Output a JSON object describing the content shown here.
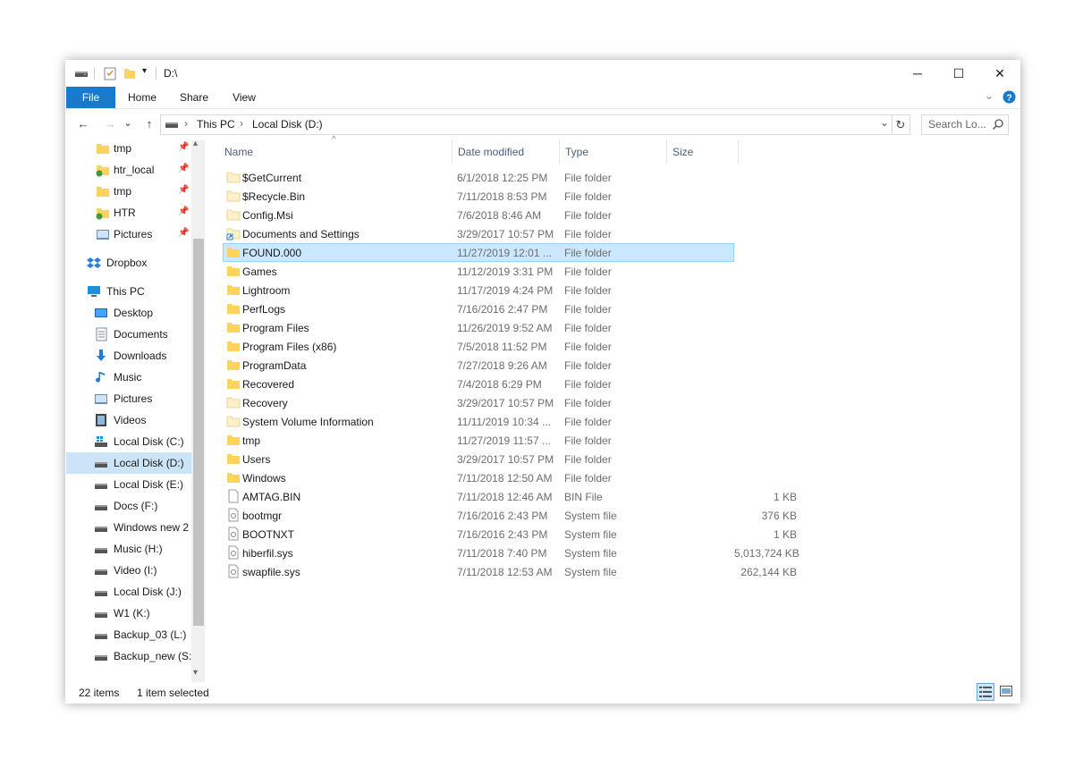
{
  "window": {
    "title": "D:\\",
    "controls": {
      "minimize": "─",
      "maximize": "☐",
      "close": "✕"
    }
  },
  "ribbon": {
    "tabs": [
      "File",
      "Home",
      "Share",
      "View"
    ],
    "expand_icon": "chevron-down-icon",
    "help_icon": "help-icon"
  },
  "address": {
    "back": "←",
    "forward": "→",
    "recent": "⌄",
    "up": "↑",
    "crumbs": [
      "This PC",
      "Local Disk (D:)"
    ],
    "separator": "›",
    "dropdown": "⌄",
    "refresh": "↻",
    "search_placeholder": "Search Lo..."
  },
  "nav": {
    "quick_access": [
      {
        "label": "tmp",
        "icon": "folder-icon",
        "pinned": true
      },
      {
        "label": "htr_local",
        "icon": "folder-sync-icon",
        "pinned": true
      },
      {
        "label": "tmp",
        "icon": "folder-icon",
        "pinned": true
      },
      {
        "label": "HTR",
        "icon": "folder-sync-icon",
        "pinned": true
      },
      {
        "label": "Pictures",
        "icon": "pictures-icon",
        "pinned": true
      }
    ],
    "dropbox": "Dropbox",
    "this_pc": "This PC",
    "pc_items": [
      {
        "label": "Desktop",
        "icon": "desktop-icon"
      },
      {
        "label": "Documents",
        "icon": "documents-icon"
      },
      {
        "label": "Downloads",
        "icon": "downloads-icon"
      },
      {
        "label": "Music",
        "icon": "music-icon"
      },
      {
        "label": "Pictures",
        "icon": "pictures-icon"
      },
      {
        "label": "Videos",
        "icon": "videos-icon"
      },
      {
        "label": "Local Disk (C:)",
        "icon": "windows-drive-icon"
      },
      {
        "label": "Local Disk (D:)",
        "icon": "drive-icon",
        "selected": true
      },
      {
        "label": "Local Disk (E:)",
        "icon": "drive-icon"
      },
      {
        "label": "Docs (F:)",
        "icon": "drive-icon"
      },
      {
        "label": "Windows new 2",
        "icon": "drive-icon"
      },
      {
        "label": "Music (H:)",
        "icon": "drive-icon"
      },
      {
        "label": "Video (I:)",
        "icon": "drive-icon"
      },
      {
        "label": "Local Disk (J:)",
        "icon": "drive-icon"
      },
      {
        "label": "W1 (K:)",
        "icon": "drive-icon"
      },
      {
        "label": "Backup_03 (L:)",
        "icon": "drive-icon"
      },
      {
        "label": "Backup_new (S:)",
        "icon": "drive-icon"
      }
    ]
  },
  "columns": {
    "name": "Name",
    "date": "Date modified",
    "type": "Type",
    "size": "Size",
    "sort_indicator": "^"
  },
  "files": [
    {
      "name": "$GetCurrent",
      "date": "6/1/2018 12:25 PM",
      "type": "File folder",
      "size": "",
      "icon": "folder-faded-icon"
    },
    {
      "name": "$Recycle.Bin",
      "date": "7/11/2018 8:53 PM",
      "type": "File folder",
      "size": "",
      "icon": "folder-faded-icon"
    },
    {
      "name": "Config.Msi",
      "date": "7/6/2018 8:46 AM",
      "type": "File folder",
      "size": "",
      "icon": "folder-faded-icon"
    },
    {
      "name": "Documents and Settings",
      "date": "3/29/2017 10:57 PM",
      "type": "File folder",
      "size": "",
      "icon": "folder-shortcut-icon"
    },
    {
      "name": "FOUND.000",
      "date": "11/27/2019 12:01 ...",
      "type": "File folder",
      "size": "",
      "icon": "folder-icon",
      "selected": true
    },
    {
      "name": "Games",
      "date": "11/12/2019 3:31 PM",
      "type": "File folder",
      "size": "",
      "icon": "folder-icon"
    },
    {
      "name": "Lightroom",
      "date": "11/17/2019 4:24 PM",
      "type": "File folder",
      "size": "",
      "icon": "folder-icon"
    },
    {
      "name": "PerfLogs",
      "date": "7/16/2016 2:47 PM",
      "type": "File folder",
      "size": "",
      "icon": "folder-icon"
    },
    {
      "name": "Program Files",
      "date": "11/26/2019 9:52 AM",
      "type": "File folder",
      "size": "",
      "icon": "folder-icon"
    },
    {
      "name": "Program Files (x86)",
      "date": "7/5/2018 11:52 PM",
      "type": "File folder",
      "size": "",
      "icon": "folder-icon"
    },
    {
      "name": "ProgramData",
      "date": "7/27/2018 9:26 AM",
      "type": "File folder",
      "size": "",
      "icon": "folder-icon"
    },
    {
      "name": "Recovered",
      "date": "7/4/2018 6:29 PM",
      "type": "File folder",
      "size": "",
      "icon": "folder-icon"
    },
    {
      "name": "Recovery",
      "date": "3/29/2017 10:57 PM",
      "type": "File folder",
      "size": "",
      "icon": "folder-faded-icon"
    },
    {
      "name": "System Volume Information",
      "date": "11/11/2019 10:34 ...",
      "type": "File folder",
      "size": "",
      "icon": "folder-faded-icon"
    },
    {
      "name": "tmp",
      "date": "11/27/2019 11:57 ...",
      "type": "File folder",
      "size": "",
      "icon": "folder-icon"
    },
    {
      "name": "Users",
      "date": "3/29/2017 10:57 PM",
      "type": "File folder",
      "size": "",
      "icon": "folder-icon"
    },
    {
      "name": "Windows",
      "date": "7/11/2018 12:50 AM",
      "type": "File folder",
      "size": "",
      "icon": "folder-icon"
    },
    {
      "name": "AMTAG.BIN",
      "date": "7/11/2018 12:46 AM",
      "type": "BIN File",
      "size": "1 KB",
      "icon": "file-icon"
    },
    {
      "name": "bootmgr",
      "date": "7/16/2016 2:43 PM",
      "type": "System file",
      "size": "376 KB",
      "icon": "system-file-icon"
    },
    {
      "name": "BOOTNXT",
      "date": "7/16/2016 2:43 PM",
      "type": "System file",
      "size": "1 KB",
      "icon": "system-file-icon"
    },
    {
      "name": "hiberfil.sys",
      "date": "7/11/2018 7:40 PM",
      "type": "System file",
      "size": "5,013,724 KB",
      "icon": "system-file-icon"
    },
    {
      "name": "swapfile.sys",
      "date": "7/11/2018 12:53 AM",
      "type": "System file",
      "size": "262,144 KB",
      "icon": "system-file-icon"
    }
  ],
  "status": {
    "count": "22 items",
    "selection": "1 item selected"
  },
  "colors": {
    "accent": "#1979ca",
    "selection": "#cce8ff",
    "selection_border": "#99d1ff",
    "folder": "#ffd35c"
  }
}
